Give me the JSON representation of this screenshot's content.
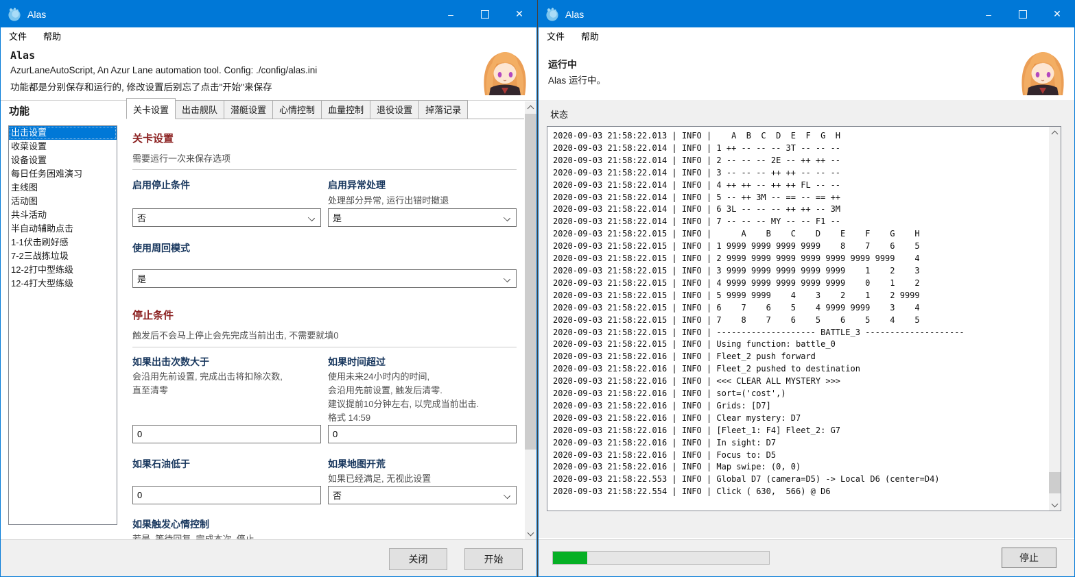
{
  "colors": {
    "accent": "#0078d7",
    "section_heading": "#8b2020",
    "field_label": "#17365d",
    "progress_green": "#06b025",
    "selection_bg": "#0078d7"
  },
  "chrome": {
    "minimize_glyph": "–",
    "close_glyph": "✕",
    "app_icon": "alas-logo"
  },
  "left_window": {
    "titlebar": {
      "title": "Alas"
    },
    "menu": [
      "文件",
      "帮助"
    ],
    "header": {
      "title": "Alas",
      "line1": "AzurLaneAutoScript, An Azur Lane automation tool. Config: ./config/alas.ini",
      "line2": "功能都是分别保存和运行的, 修改设置后别忘了点击\"开始\"来保存"
    },
    "sidebar": {
      "heading": "功能",
      "selected_index": 0,
      "items": [
        "出击设置",
        "收菜设置",
        "设备设置",
        "每日任务困难演习",
        "主线图",
        "活动图",
        "共斗活动",
        "半自动辅助点击",
        "1-1伏击刷好感",
        "7-2三战拣垃圾",
        "12-2打中型练级",
        "12-4打大型练级"
      ]
    },
    "tabs": {
      "active_index": 0,
      "items": [
        "关卡设置",
        "出击舰队",
        "潜艇设置",
        "心情控制",
        "血量控制",
        "退役设置",
        "掉落记录"
      ]
    },
    "panel": {
      "section1_title": "关卡设置",
      "section1_desc": "需要运行一次来保存选项",
      "enable_stop_label": "启用停止条件",
      "enable_stop_value": "否",
      "exception_label": "启用异常处理",
      "exception_desc": "处理部分异常, 运行出错时撤退",
      "exception_value": "是",
      "loop_label": "使用周回模式",
      "loop_value": "是",
      "section2_title": "停止条件",
      "section2_desc": "触发后不会马上停止会先完成当前出击, 不需要就填0",
      "count_label": "如果出击次数大于",
      "count_desc1": "会沿用先前设置, 完成出击将扣除次数,",
      "count_desc2": "直至清零",
      "count_value": "0",
      "time_label": "如果时间超过",
      "time_desc1": "使用未来24小时内的时间,",
      "time_desc2": "会沿用先前设置, 触发后清零.",
      "time_desc3": "建议提前10分钟左右, 以完成当前出击.",
      "time_desc4": "格式 14:59",
      "time_value": "0",
      "oil_label": "如果石油低于",
      "oil_value": "0",
      "map_label": "如果地图开荒",
      "map_desc": "如果已经满足, 无视此设置",
      "map_value": "否",
      "emotion_label": "如果触发心情控制",
      "emotion_desc": "若是, 等待回复, 完成本次, 停止"
    },
    "footer": {
      "close": "关闭",
      "start": "开始"
    }
  },
  "right_window": {
    "titlebar": {
      "title": "Alas"
    },
    "menu": [
      "文件",
      "帮助"
    ],
    "header": {
      "title": "运行中",
      "line1": "Alas 运行中。"
    },
    "status_label": "状态",
    "log_lines": [
      "2020-09-03 21:58:22.013 | INFO |    A  B  C  D  E  F  G  H",
      "2020-09-03 21:58:22.014 | INFO | 1 ++ -- -- -- 3T -- -- --",
      "2020-09-03 21:58:22.014 | INFO | 2 -- -- -- 2E -- ++ ++ --",
      "2020-09-03 21:58:22.014 | INFO | 3 -- -- -- ++ ++ -- -- --",
      "2020-09-03 21:58:22.014 | INFO | 4 ++ ++ -- ++ ++ FL -- --",
      "2020-09-03 21:58:22.014 | INFO | 5 -- ++ 3M -- == -- == ++",
      "2020-09-03 21:58:22.014 | INFO | 6 3L -- -- -- ++ ++ -- 3M",
      "2020-09-03 21:58:22.014 | INFO | 7 -- -- -- MY -- -- F1 --",
      "2020-09-03 21:58:22.015 | INFO |      A    B    C    D    E    F    G    H",
      "2020-09-03 21:58:22.015 | INFO | 1 9999 9999 9999 9999    8    7    6    5",
      "2020-09-03 21:58:22.015 | INFO | 2 9999 9999 9999 9999 9999 9999 9999    4",
      "2020-09-03 21:58:22.015 | INFO | 3 9999 9999 9999 9999 9999    1    2    3",
      "2020-09-03 21:58:22.015 | INFO | 4 9999 9999 9999 9999 9999    0    1    2",
      "2020-09-03 21:58:22.015 | INFO | 5 9999 9999    4    3    2    1    2 9999",
      "2020-09-03 21:58:22.015 | INFO | 6    7    6    5    4 9999 9999    3    4",
      "2020-09-03 21:58:22.015 | INFO | 7    8    7    6    5    6    5    4    5",
      "2020-09-03 21:58:22.015 | INFO | -------------------- BATTLE_3 --------------------",
      "2020-09-03 21:58:22.015 | INFO | Using function: battle_0",
      "2020-09-03 21:58:22.016 | INFO | Fleet_2 push forward",
      "2020-09-03 21:58:22.016 | INFO | Fleet_2 pushed to destination",
      "2020-09-03 21:58:22.016 | INFO | <<< CLEAR ALL MYSTERY >>>",
      "2020-09-03 21:58:22.016 | INFO | sort=('cost',)",
      "2020-09-03 21:58:22.016 | INFO | Grids: [D7]",
      "2020-09-03 21:58:22.016 | INFO | Clear mystery: D7",
      "2020-09-03 21:58:22.016 | INFO | [Fleet_1: F4] Fleet_2: G7",
      "2020-09-03 21:58:22.016 | INFO | In sight: D7",
      "2020-09-03 21:58:22.016 | INFO | Focus to: D5",
      "2020-09-03 21:58:22.016 | INFO | Map swipe: (0, 0)",
      "2020-09-03 21:58:22.553 | INFO | Global D7 (camera=D5) -> Local D6 (center=D4)",
      "2020-09-03 21:58:22.554 | INFO | Click ( 630,  566) @ D6"
    ],
    "footer": {
      "progress_percent": 16,
      "stop": "停止"
    }
  }
}
